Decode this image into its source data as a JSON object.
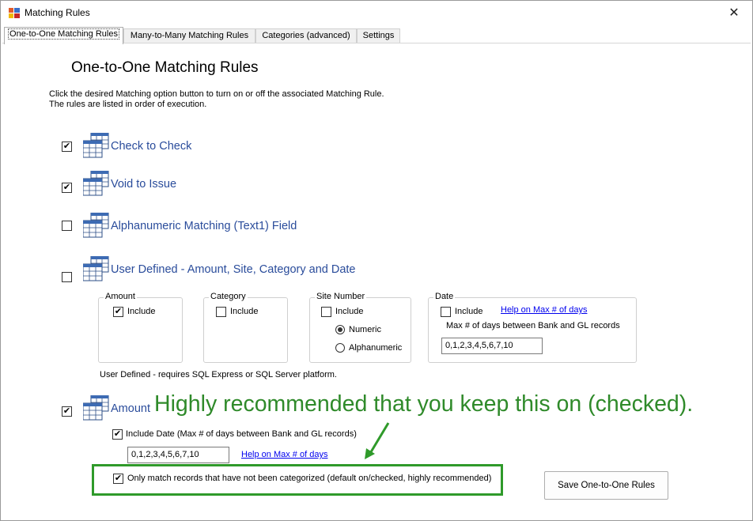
{
  "window": {
    "title": "Matching Rules",
    "close_glyph": "✕"
  },
  "tabs": [
    {
      "label": "One-to-One Matching Rules",
      "active": true
    },
    {
      "label": "Many-to-Many Matching Rules"
    },
    {
      "label": "Categories (advanced)"
    },
    {
      "label": "Settings"
    }
  ],
  "page": {
    "heading": "One-to-One Matching Rules",
    "description_line1": "Click the desired Matching option button to turn on or off the associated Matching Rule.",
    "description_line2": "The rules are listed in order of execution."
  },
  "rules": {
    "check_to_check": {
      "label": "Check to Check",
      "checked": true
    },
    "void_to_issue": {
      "label": "Void to Issue",
      "checked": true
    },
    "alphanumeric": {
      "label": "Alphanumeric Matching (Text1) Field",
      "checked": false
    },
    "user_defined": {
      "label": "User Defined - Amount, Site, Category and Date",
      "checked": false
    },
    "amount": {
      "label": "Amount",
      "checked": true
    }
  },
  "user_defined_groups": {
    "amount": {
      "title": "Amount",
      "include_label": "Include",
      "include_checked": true
    },
    "category": {
      "title": "Category",
      "include_label": "Include",
      "include_checked": false
    },
    "site_number": {
      "title": "Site Number",
      "include_label": "Include",
      "include_checked": false,
      "numeric_label": "Numeric",
      "alphanumeric_label": "Alphanumeric",
      "selected": "Numeric"
    },
    "date": {
      "title": "Date",
      "include_label": "Include",
      "include_checked": false,
      "help_link": "Help on Max # of days",
      "max_days_label": "Max # of days between Bank and GL records",
      "max_days_value": "0,1,2,3,4,5,6,7,10"
    },
    "note": "User Defined - requires SQL Express or SQL Server platform."
  },
  "amount_options": {
    "include_date_label": "Include Date (Max # of days between Bank and GL records)",
    "include_date_checked": true,
    "max_days_value": "0,1,2,3,4,5,6,7,10",
    "help_link": "Help on Max # of days",
    "only_uncategorized_label": "Only match records that have not been categorized (default on/checked, highly recommended)",
    "only_uncategorized_checked": true
  },
  "callout": {
    "text": "Highly recommended that you keep this on (checked).",
    "color": "#2f8a2a"
  },
  "buttons": {
    "save_label": "Save One-to-One Rules"
  },
  "icons": {
    "rule_icon": "table-grid-icon",
    "check_glyph": "✔"
  }
}
